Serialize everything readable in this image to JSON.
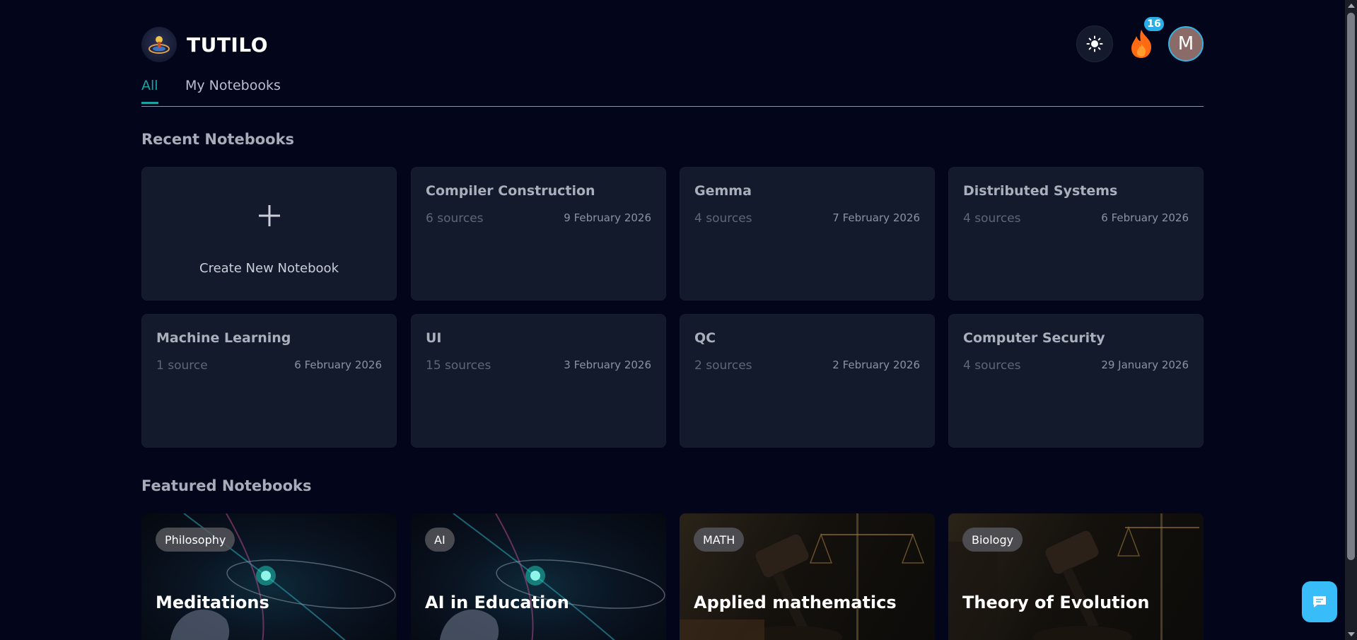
{
  "header": {
    "app_name": "TUTILO",
    "streak_count": "16",
    "avatar_initial": "M"
  },
  "tabs": [
    {
      "label": "All",
      "active": true
    },
    {
      "label": "My Notebooks",
      "active": false
    }
  ],
  "recent": {
    "title": "Recent Notebooks",
    "create_label": "Create New Notebook",
    "notebooks": [
      {
        "title": "Compiler Construction",
        "sources": "6 sources",
        "date": "9 February 2026"
      },
      {
        "title": "Gemma",
        "sources": "4 sources",
        "date": "7 February 2026"
      },
      {
        "title": "Distributed Systems",
        "sources": "4 sources",
        "date": "6 February 2026"
      },
      {
        "title": "Machine Learning",
        "sources": "1 source",
        "date": "6 February 2026"
      },
      {
        "title": "UI",
        "sources": "15 sources",
        "date": "3 February 2026"
      },
      {
        "title": "QC",
        "sources": "2 sources",
        "date": "2 February 2026"
      },
      {
        "title": "Computer Security",
        "sources": "4 sources",
        "date": "29 January 2026"
      }
    ]
  },
  "featured": {
    "title": "Featured Notebooks",
    "notebooks": [
      {
        "tag": "Philosophy",
        "title": "Meditations"
      },
      {
        "tag": "AI",
        "title": "AI in Education"
      },
      {
        "tag": "MATH",
        "title": "Applied mathematics"
      },
      {
        "tag": "Biology",
        "title": "Theory of Evolution"
      }
    ]
  },
  "colors": {
    "background": "#03061a",
    "card": "#131a2b",
    "accent_teal": "#1aa3a3",
    "badge_blue": "#2aaee8",
    "chat_blue": "#38bdf8"
  },
  "icons": {
    "logo": "globe-logo-icon",
    "theme": "sun-icon",
    "streak": "flame-icon",
    "create": "plus-icon",
    "chat": "chat-bubble-icon"
  }
}
